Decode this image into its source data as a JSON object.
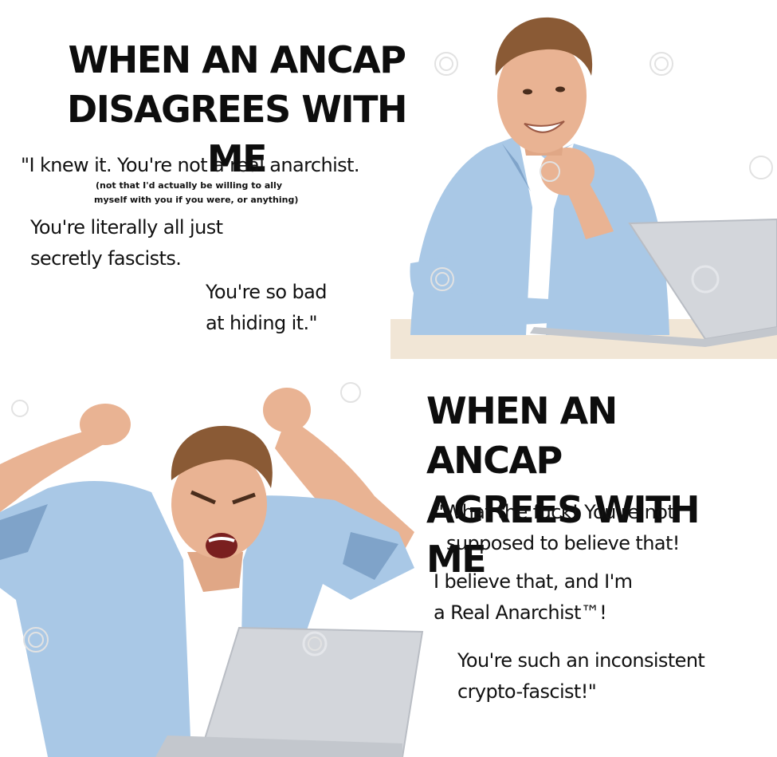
{
  "top_panel": {
    "headline": [
      "WHEN AN ANCAP",
      "DISAGREES WITH ME"
    ],
    "quote_line_1": "\"I knew it. You're not a real anarchist.",
    "aside_line_1": "(not that I'd actually be willing to ally",
    "aside_line_2": "myself with you if you were, or anything)",
    "quote_line_2": "You're literally all just",
    "quote_line_3": "secretly fascists.",
    "quote_line_4": "You're so bad",
    "quote_line_5": "at hiding it.\""
  },
  "bottom_panel": {
    "headline": [
      "WHEN AN ANCAP",
      "AGREES WITH ME"
    ],
    "quote_line_1": "\"What the fuck! You're not",
    "quote_line_2": "supposed to believe that!",
    "quote_line_3": "I believe that, and I'm",
    "quote_line_4": "a Real Anarchist™!",
    "quote_line_5": "You're such an inconsistent",
    "quote_line_6": "crypto-fascist!\""
  },
  "images": {
    "top_photo": "smiling-man-at-laptop-photo",
    "bottom_photo": "angry-man-fists-raised-at-laptop-photo",
    "watermark_icon": "stock-photo-swirl-watermark-icon"
  },
  "colors": {
    "shirt": "#a9c8e6",
    "shirt_shadow": "#7fa3c9",
    "skin": "#e9b393",
    "hair": "#8a5a35",
    "laptop": "#d3d6db",
    "desk": "#f1e6d6",
    "text": "#111111"
  }
}
